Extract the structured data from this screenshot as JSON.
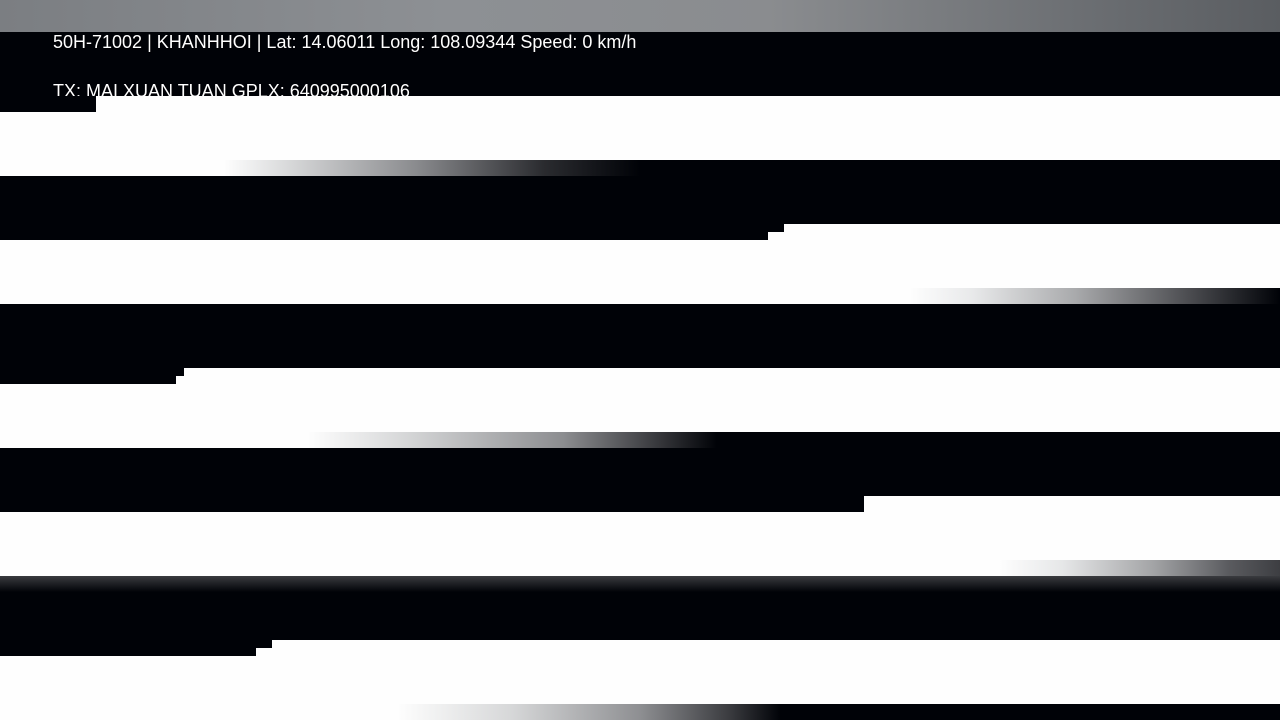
{
  "overlay": {
    "line1": "50H-71002 | KHANHHOI | Lat: 14.06011 Long: 108.09344 Speed: 0 km/h",
    "line2": "TX: MAI XUAN TUAN GPLX: 640995000106"
  },
  "colors": {
    "black_band": "#000207",
    "white_band": "#fefefe",
    "overlay_text": "#ffffff"
  }
}
